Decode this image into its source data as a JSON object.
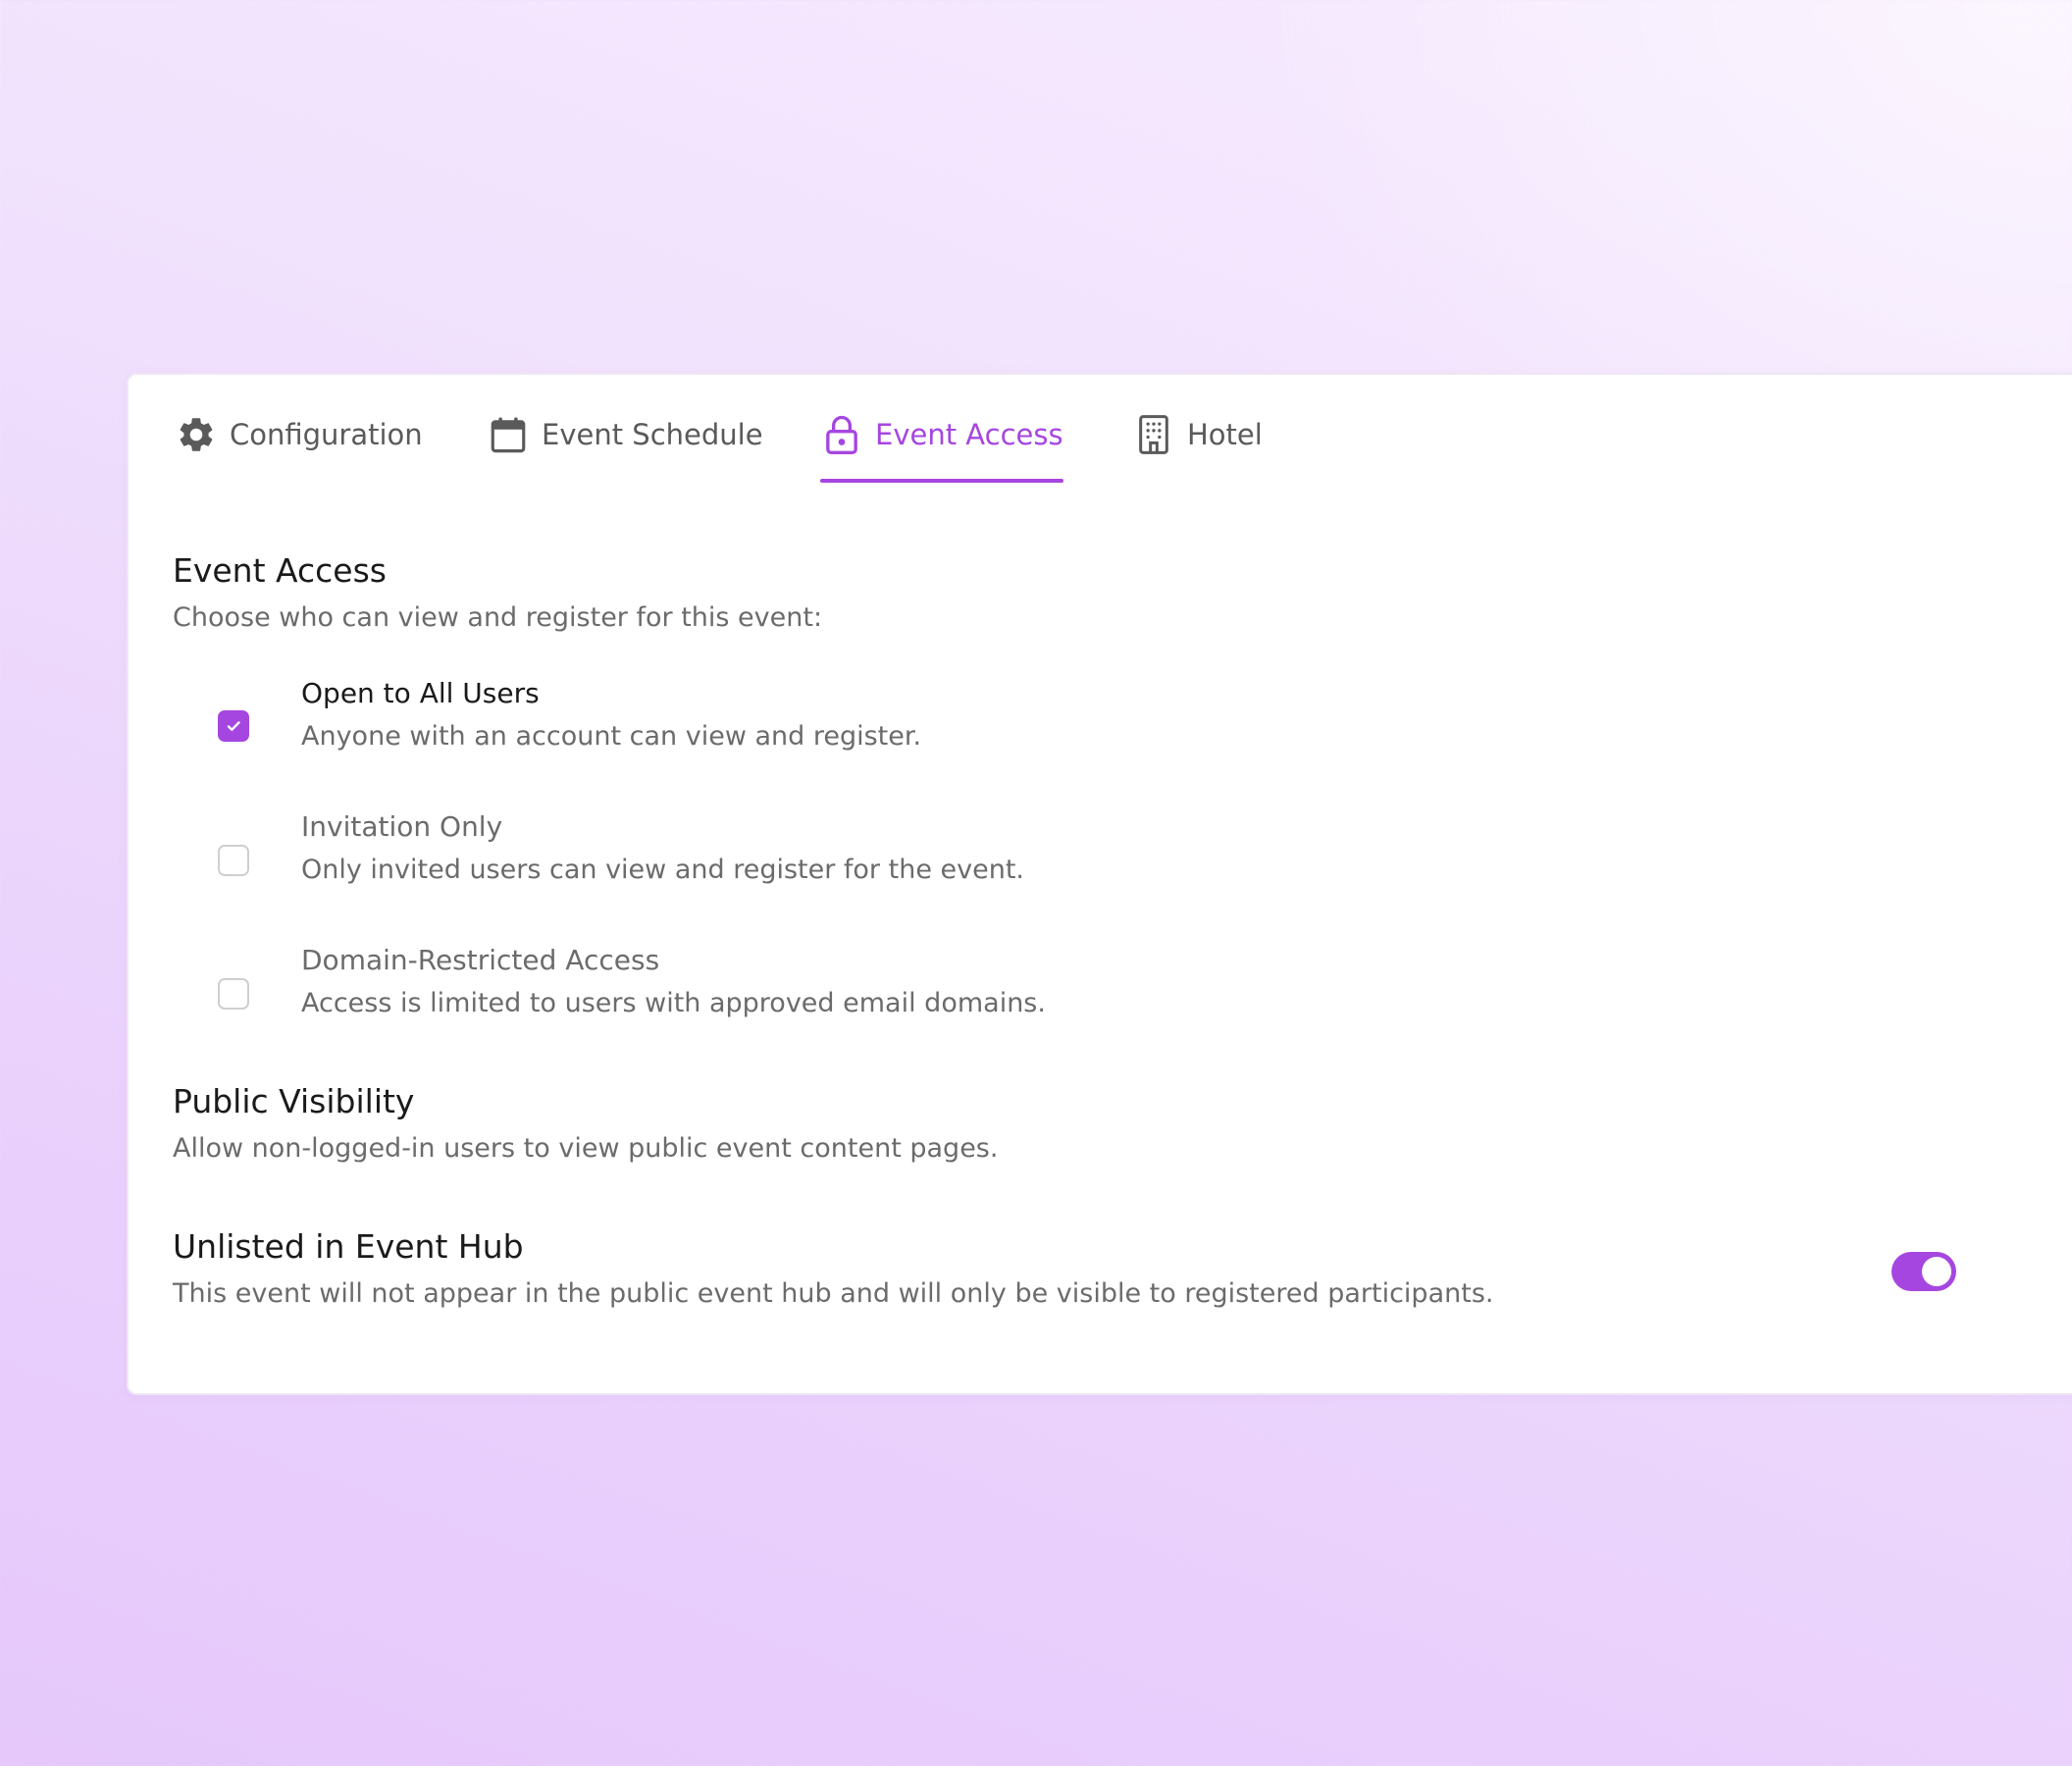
{
  "colors": {
    "accent": "#a646e0",
    "text_primary": "#1a1a1a",
    "text_secondary": "#6b6b6b",
    "icon_gray": "#5a5a5a"
  },
  "tabs": [
    {
      "label": "Configuration",
      "icon": "gear-icon",
      "active": false
    },
    {
      "label": "Event Schedule",
      "icon": "calendar-icon",
      "active": false
    },
    {
      "label": "Event Access",
      "icon": "lock-icon",
      "active": true
    },
    {
      "label": "Hotel",
      "icon": "building-icon",
      "active": false
    }
  ],
  "event_access": {
    "title": "Event Access",
    "description": "Choose who can view and register for this event:",
    "options": [
      {
        "title": "Open to All Users",
        "description": "Anyone with an account can view and register.",
        "checked": true
      },
      {
        "title": "Invitation Only",
        "description": "Only invited users can view and register for the event.",
        "checked": false
      },
      {
        "title": "Domain-Restricted Access",
        "description": "Access is limited to users with approved email domains.",
        "checked": false
      }
    ]
  },
  "public_visibility": {
    "title": "Public Visibility",
    "description": "Allow non-logged-in users to view public event content pages."
  },
  "unlisted": {
    "title": "Unlisted in Event Hub",
    "description": "This event will not appear in the public event hub and will only be visible to registered participants.",
    "enabled": true
  }
}
